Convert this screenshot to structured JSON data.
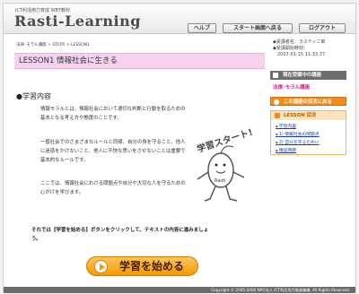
{
  "header": {
    "tagline": "ICT利活用力育成 WBT教材",
    "logo": "Rasti-Learning",
    "buttons": [
      "ヘルプ",
      "スタート画面へ戻る",
      "ログアウト"
    ]
  },
  "breadcrumb": "法律･モラル講座 > STEP5 > LESSON1",
  "lesson": {
    "title": "LESSON1  情報社会に生きる",
    "section_title": "●学習内容",
    "paragraphs": [
      "情報モラルとは、情報社会において適切な判断と行動を取るための基本となる考え方や態度のことです。",
      "一般社会でのさまざまなルールと同様、自分の身を守ること、他人に迷惑をかけないこと、他人に不快な思いをさせないことは重要で基本的なルールです。",
      "ここでは、情報社会における問題点や自分や大切な人を守るための心がけを学びます。"
    ],
    "notice": "それでは【学習を始める】ボタンをクリックして、テキストの内容に進みましょう。",
    "start_button": "学習を始める",
    "mascot_text": "学習スタート!",
    "mascot_name": "Rasti"
  },
  "user": {
    "line1": "◆受講者名：ラスティ二郎",
    "line2": "◆受講開始時刻：",
    "line3": "2007-01-15 11:33:37"
  },
  "sidebar": {
    "current_heading": "現在受講中の講座",
    "current_course": "法律･モラル講座",
    "choose_button": "この講座の目次に戻る",
    "lesson_heading": "LESSON 目次",
    "lesson_items": [
      "学習内容",
      "1) 情報社会の問題点",
      "2) 自分を守るために",
      "確認問題"
    ]
  },
  "footer": "Copyright © 2005-2006 NPO法人 ICT利活用力推進機構. All Rights Reserved."
}
